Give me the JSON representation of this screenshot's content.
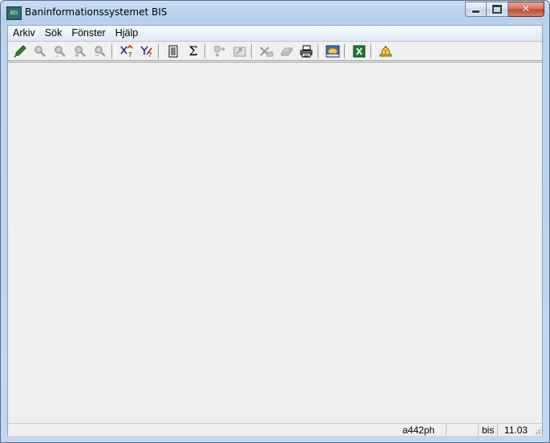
{
  "window": {
    "title": "Baninformationssystemet BIS",
    "icon": "bis-app-icon",
    "icon_text": "BIS"
  },
  "caption": {
    "minimize": "minimize-icon",
    "maximize": "maximize-icon",
    "close_label": "✕"
  },
  "menu": {
    "items": [
      {
        "label": "Arkiv"
      },
      {
        "label": "Sök"
      },
      {
        "label": "Fönster"
      },
      {
        "label": "Hjälp"
      }
    ]
  },
  "toolbar": {
    "icons": [
      "pen-icon",
      "search-icon",
      "search-range-icon",
      "zoom-in-icon",
      "zoom-out-icon",
      "axis-query-icon",
      "axis-query-2-icon",
      "document-list-icon",
      "sigma-icon",
      "export-icon",
      "image-export-icon",
      "delete-icon",
      "eraser-icon",
      "print-icon",
      "map-icon",
      "excel-icon",
      "help-bell-icon"
    ],
    "sigma_glyph": "Σ"
  },
  "status": {
    "user": "a442ph",
    "blank": "",
    "db": "bis",
    "version": "11.03"
  },
  "colors": {
    "title_bar": "#bcd3ee",
    "workspace": "#f0f0f0",
    "close_button": "#c0462d",
    "excel_green": "#1e7b34"
  }
}
